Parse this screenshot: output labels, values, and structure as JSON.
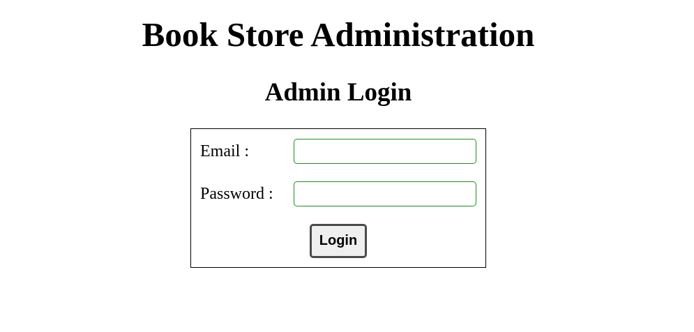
{
  "header": {
    "site_title": "Book Store Administration",
    "login_title": "Admin Login"
  },
  "login_form": {
    "email_label": "Email :",
    "email_value": "",
    "password_label": "Password :",
    "password_value": "",
    "login_button_label": "Login"
  },
  "colors": {
    "input_border": "#1f8f1f",
    "box_border": "#000000",
    "button_background": "#efefef",
    "button_border": "#4a4a4a"
  }
}
